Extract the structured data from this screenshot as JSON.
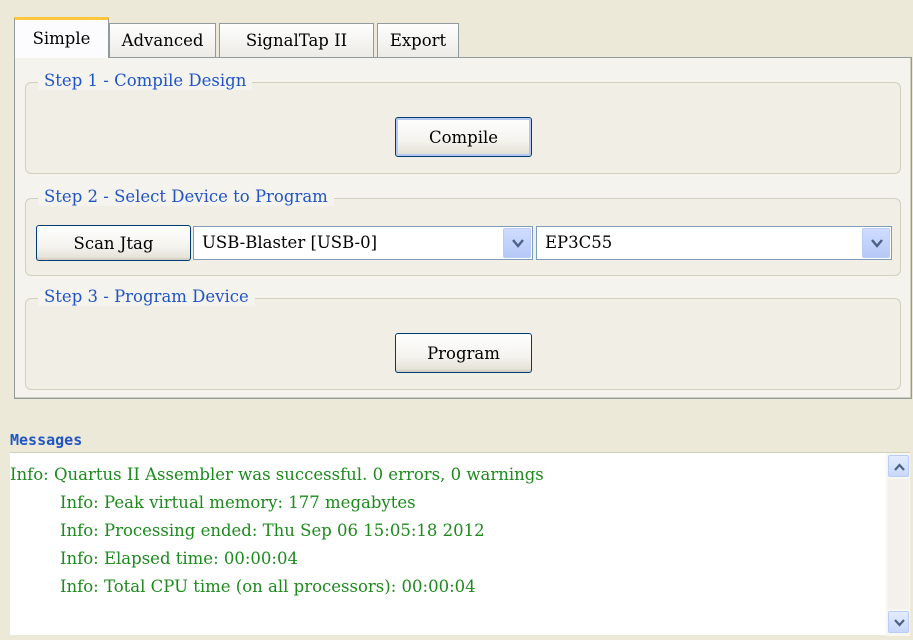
{
  "tabs": [
    {
      "label": "Simple",
      "active": true
    },
    {
      "label": "Advanced",
      "active": false
    },
    {
      "label": "SignalTap II",
      "active": false
    },
    {
      "label": "Export",
      "active": false
    }
  ],
  "step1": {
    "title": "Step 1 - Compile Design",
    "button": "Compile"
  },
  "step2": {
    "title": "Step 2 - Select Device to Program",
    "scan_button": "Scan Jtag",
    "cable_value": "USB-Blaster [USB-0]",
    "device_value": "EP3C55"
  },
  "step3": {
    "title": "Step 3 - Program Device",
    "button": "Program"
  },
  "messages": {
    "title": "Messages",
    "lines": [
      "Info: Quartus II Assembler was successful. 0 errors, 0 warnings",
      "Info: Peak virtual memory: 177 megabytes",
      "Info: Processing ended: Thu Sep 06 15:05:18 2012",
      "Info: Elapsed time: 00:00:04",
      "Info: Total CPU time (on all processors): 00:00:04"
    ]
  },
  "colors": {
    "accent": "#2155c6",
    "message_text": "#1c8a1c",
    "active_tab": "#ffc83c"
  },
  "icons": {
    "dropdown": "chevron-down-icon",
    "scroll_up": "scroll-up-icon",
    "scroll_down": "scroll-down-icon"
  }
}
